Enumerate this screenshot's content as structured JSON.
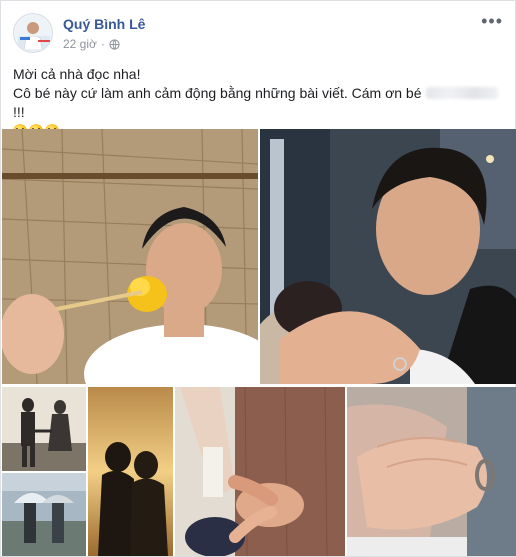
{
  "post": {
    "author": "Quý Bình Lê",
    "time": "22 giờ",
    "separator": "·",
    "more_icon": "more-dots-icon",
    "privacy_icon": "globe-icon",
    "line1": "Mời cả nhà đọc nha!",
    "line2_before": "Cô bé này cứ làm anh cảm động bằng những bài viết. Cám ơn bé",
    "line2_after": "!!!",
    "emojis": [
      "flushed-emoji",
      "flushed-emoji",
      "flushed-emoji"
    ]
  },
  "photos": [
    {
      "name": "photo-flower-selfie"
    },
    {
      "name": "photo-hug-selfie"
    },
    {
      "name": "photo-couple-sunset"
    },
    {
      "name": "photo-couple-kiss"
    },
    {
      "name": "photo-holding-hands"
    },
    {
      "name": "photo-hand-ring"
    }
  ],
  "colors": {
    "author": "#385898",
    "meta": "#90949c",
    "text": "#1c1e21"
  }
}
